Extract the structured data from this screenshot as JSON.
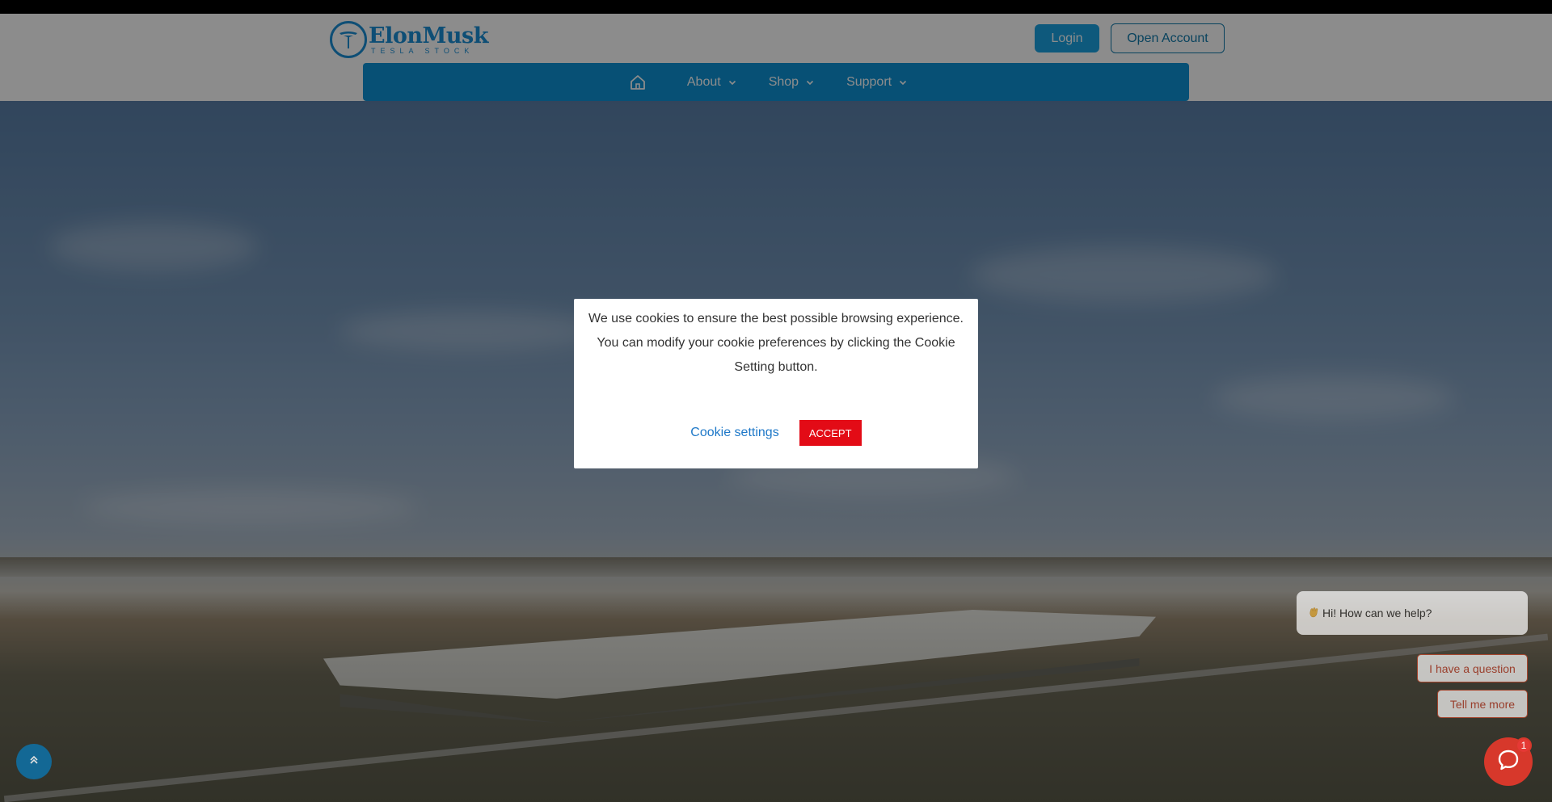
{
  "brand": {
    "name": "ElonMusk",
    "tagline": "TESLA STOCK",
    "accent_color": "#1a8fd6"
  },
  "header": {
    "login_label": "Login",
    "open_account_label": "Open Account"
  },
  "nav": {
    "home_icon": "home-icon",
    "items": [
      {
        "label": "About",
        "icon": "chevron-down-icon"
      },
      {
        "label": "Shop",
        "icon": "chevron-down-icon"
      },
      {
        "label": "Support",
        "icon": "chevron-down-icon"
      }
    ],
    "bar_color": "#0e93d5"
  },
  "cookie": {
    "message": "We use cookies to ensure the best possible browsing experience. You can modify your cookie preferences by clicking the Cookie Setting button.",
    "settings_label": "Cookie settings",
    "accept_label": "ACCEPT",
    "accept_color": "#e30b16"
  },
  "chat": {
    "greeting": "Hi! How can we help?",
    "greeting_icon": "waving-hand-icon",
    "options": [
      "I have a question",
      "Tell me more"
    ],
    "launcher_icon": "chat-icon",
    "badge_count": "1",
    "launcher_color": "#d7382b"
  },
  "scroll_top": {
    "icon": "double-chevron-up-icon"
  }
}
